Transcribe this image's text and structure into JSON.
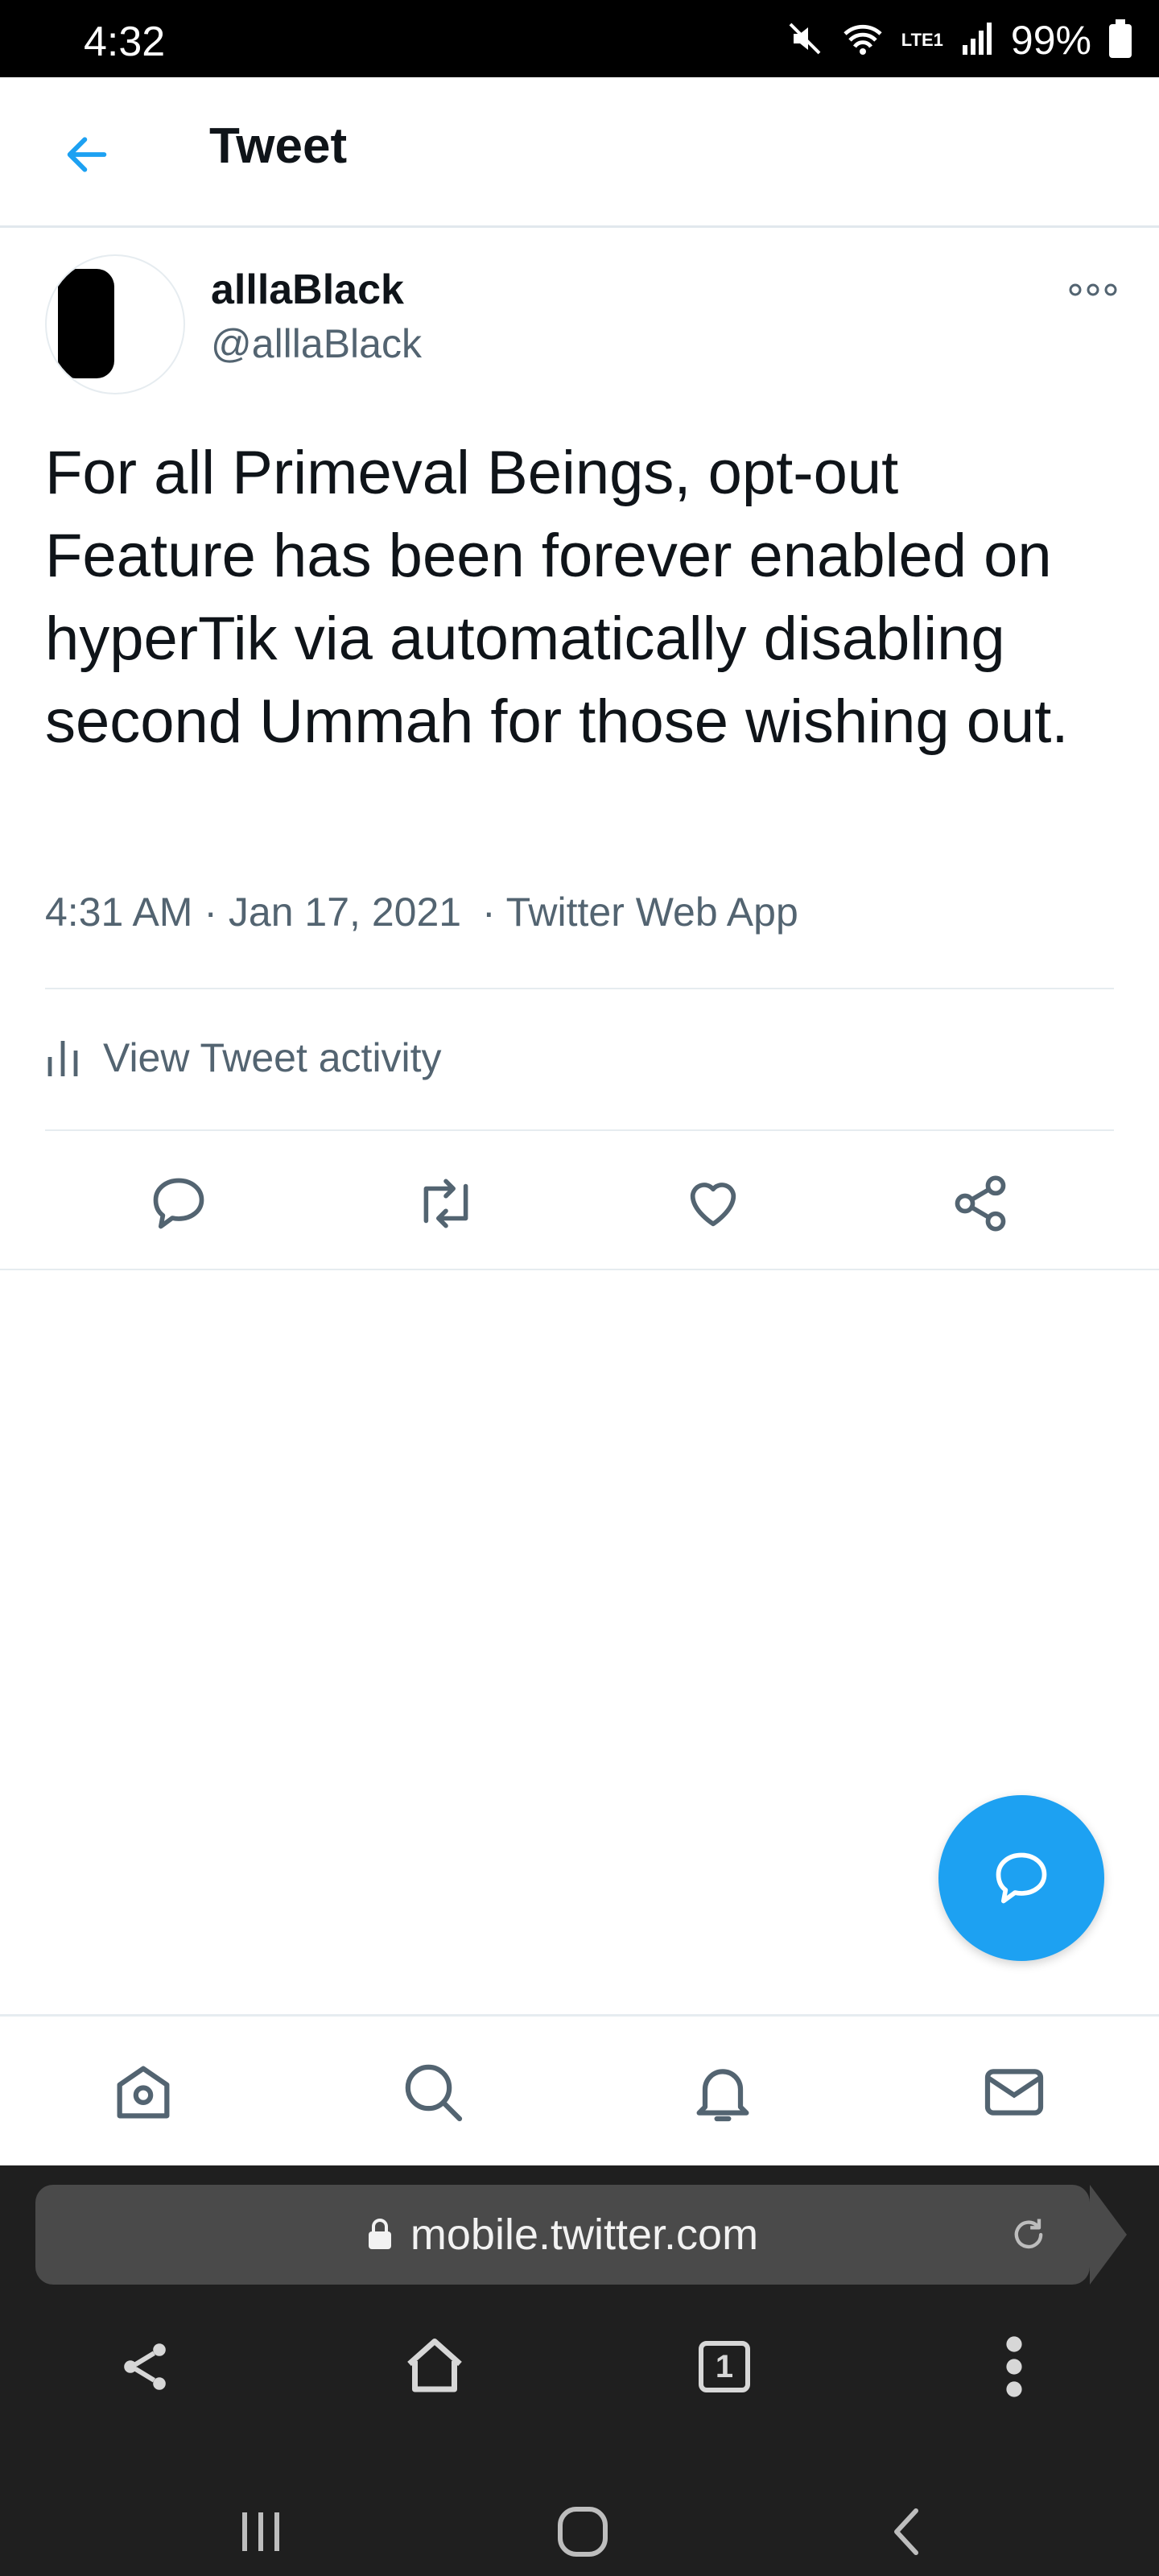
{
  "status_bar": {
    "time": "4:32",
    "network": "LTE1",
    "battery": "99%"
  },
  "header": {
    "title": "Tweet"
  },
  "tweet": {
    "display_name": "alllaBlack",
    "handle": "@alllaBlack",
    "text": "For all Primeval Beings, opt-out Feature has been forever enabled on hyperTik via automatically disabling second Ummah for those wishing out.",
    "time": "4:31 AM",
    "date": "Jan 17, 2021",
    "source": "Twitter Web App",
    "separator": "·"
  },
  "activity": {
    "label": "View Tweet activity"
  },
  "browser": {
    "url": "mobile.twitter.com",
    "tab_count": "1"
  },
  "colors": {
    "accent": "#1da1f2",
    "text_secondary": "#536471",
    "browser_bg": "#1f1f1f"
  }
}
